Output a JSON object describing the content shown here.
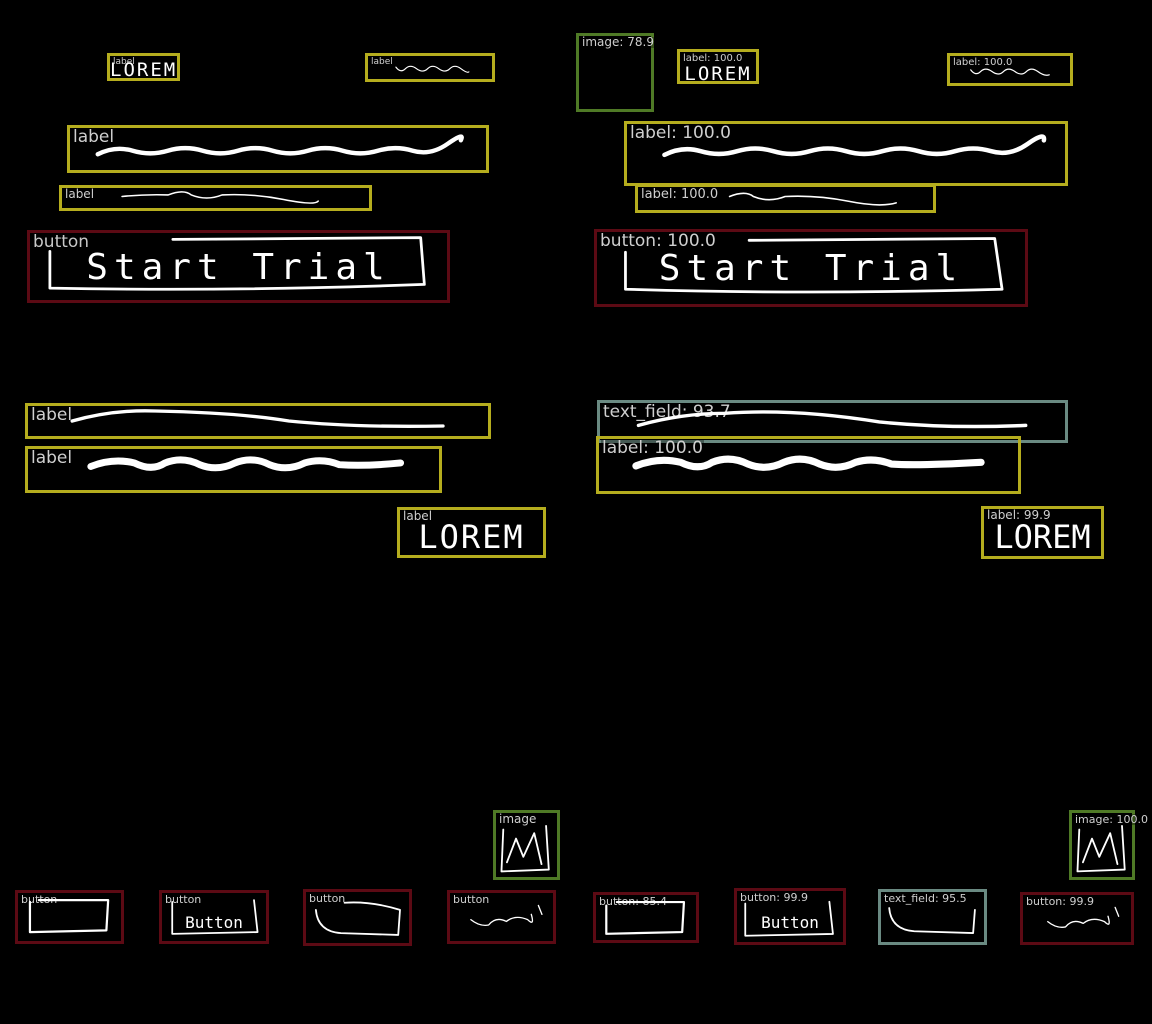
{
  "labels": {
    "l1": "label",
    "l2": "label",
    "l3": "label",
    "l4": "label",
    "l5": "label",
    "l6": "label",
    "l7": "label",
    "l8": "label",
    "r1": "label: 100.0",
    "r2": "label: 100.0",
    "r3": "label: 100.0",
    "r4": "label: 100.0",
    "r5": "label: 100.0",
    "r6": "label: 99.9",
    "rimg1": "image: 78.9",
    "limg": "image",
    "rimg2": "image: 100.0",
    "lbtn_start": "button",
    "rbtn_start": "button: 100.0",
    "rtf1": "text_field: 93.7",
    "lb1": "button",
    "lb2": "button",
    "lb3": "button",
    "lb4": "button",
    "rb1": "button: 85.4",
    "rb2": "button: 99.9",
    "rtf2": "text_field: 95.5",
    "rb4": "button: 99.9"
  },
  "handwritten": {
    "lorem": "LOREM",
    "start_trial": "Start Trial",
    "button": "Button",
    "m_glyph": "M"
  },
  "colors": {
    "label_box": "#b5ad1e",
    "button_box": "#5c0a14",
    "image_box": "#4f7a26",
    "text_field_box": "#6a8a82",
    "background": "#000000",
    "ink": "#ffffff"
  }
}
